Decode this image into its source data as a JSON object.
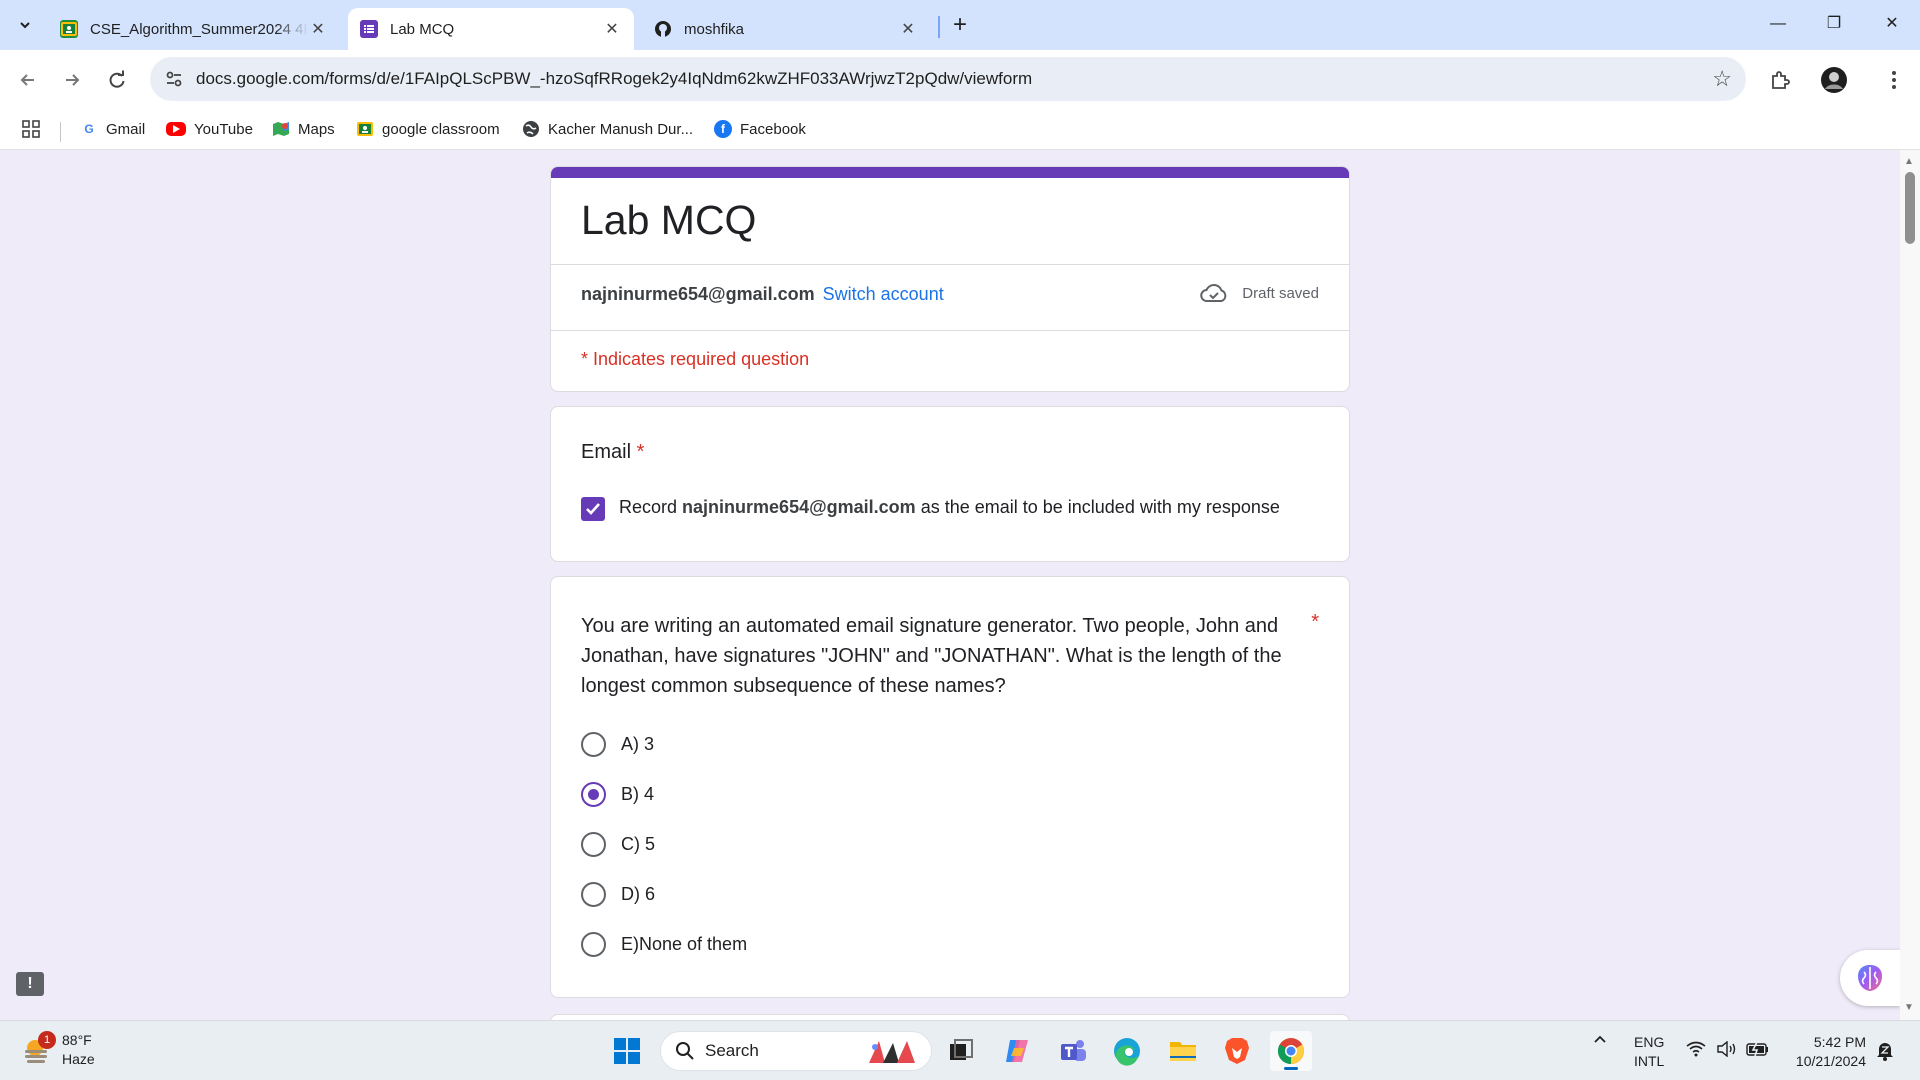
{
  "browser": {
    "tabs": [
      {
        "title": "CSE_Algorithm_Summer2024 4E",
        "favicon": "google-classroom-icon"
      },
      {
        "title": "Lab MCQ",
        "favicon": "google-forms-icon"
      },
      {
        "title": "moshfika",
        "favicon": "github-icon"
      }
    ],
    "url": "docs.google.com/forms/d/e/1FAIpQLScPBW_-hzoSqfRRogek2y4IqNdm62kwZHF033AWrjwzT2pQdw/viewform",
    "bookmarks": [
      {
        "label": "Gmail",
        "icon": "google-icon"
      },
      {
        "label": "YouTube",
        "icon": "youtube-icon"
      },
      {
        "label": "Maps",
        "icon": "maps-icon"
      },
      {
        "label": "google classroom",
        "icon": "google-classroom-icon"
      },
      {
        "label": "Kacher Manush Dur...",
        "icon": "globe-icon"
      },
      {
        "label": "Facebook",
        "icon": "facebook-icon"
      }
    ]
  },
  "form": {
    "title": "Lab MCQ",
    "account_email": "najninurme654@gmail.com",
    "switch_account": "Switch account",
    "draft_status": "Draft saved",
    "required_note": "* Indicates required question",
    "email_question": {
      "label": "Email",
      "required_mark": "*",
      "record_prefix": "Record",
      "record_email": "najninurme654@gmail.com",
      "record_suffix": "as the email to be included with my response",
      "checked": true
    },
    "mcq": {
      "question": "You are writing an automated email signature generator. Two people, John and Jonathan, have signatures \"JOHN\" and \"JONATHAN\". What is the length of the longest common subsequence of these names?",
      "required_mark": "*",
      "options": [
        "A) 3",
        "B) 4",
        "C) 5",
        "D) 6",
        "E)None of them"
      ],
      "selected": "B) 4"
    }
  },
  "taskbar": {
    "weather_temp": "88°F",
    "weather_desc": "Haze",
    "weather_badge": "1",
    "search_placeholder": "Search",
    "lang_line1": "ENG",
    "lang_line2": "INTL",
    "time": "5:42 PM",
    "date": "10/21/2024"
  },
  "colors": {
    "accent": "#673ab7",
    "required": "#d93025",
    "link": "#1a73e8",
    "background": "#f0ebf8"
  }
}
